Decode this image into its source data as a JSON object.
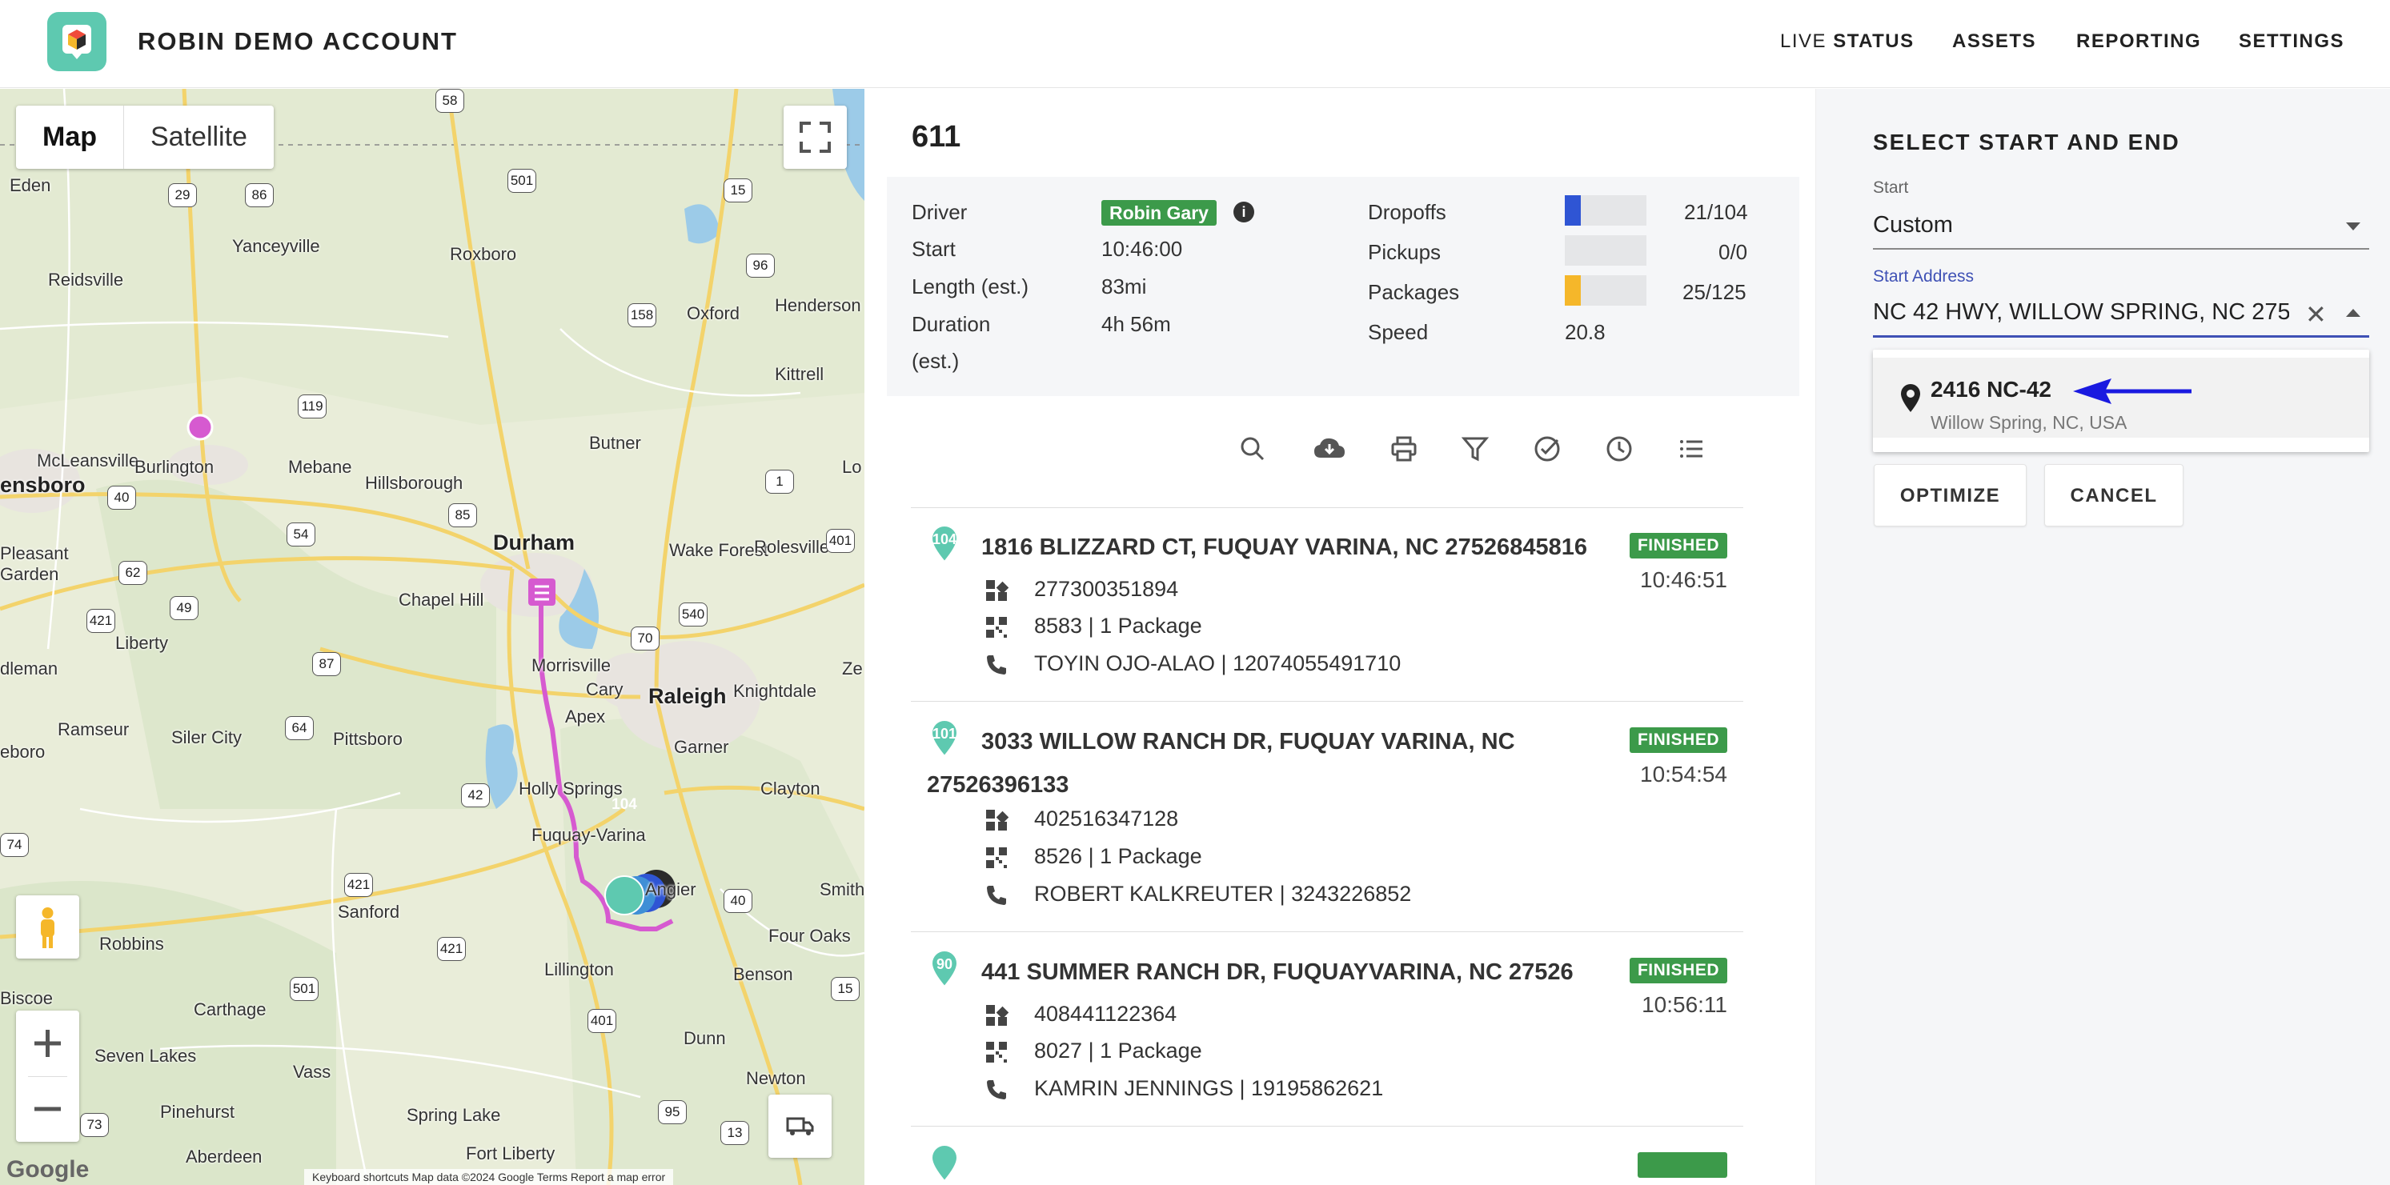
{
  "header": {
    "account_name": "ROBIN DEMO ACCOUNT",
    "nav": {
      "live_word": "LIVE",
      "status_word": "STATUS",
      "assets": "ASSETS",
      "reporting": "REPORTING",
      "settings": "SETTINGS"
    }
  },
  "map": {
    "type_map": "Map",
    "type_satellite": "Satellite",
    "cities": [
      "Eden",
      "Yanceyville",
      "Roxboro",
      "Reidsville",
      "Oxford",
      "Henderson",
      "Kittrell",
      "Butner",
      "McLeansville",
      "Burlington",
      "Mebane",
      "Hillsborough",
      "ensboro",
      "Durham",
      "Wake Forest",
      "Pleasant Garden",
      "Chapel Hill",
      "Rolesville",
      "Liberty",
      "Morrisville",
      "Cary",
      "Raleigh",
      "Knightdale",
      "Apex",
      "dleman",
      "Ramseur",
      "Siler City",
      "Pittsboro",
      "Garner",
      "Holly Springs",
      "Clayton",
      "Fuquay-Varina",
      "Angier",
      "Smith",
      "Four Oaks",
      "Sanford",
      "Robbins",
      "Lillington",
      "Benson",
      "Biscoe",
      "Carthage",
      "Seven Lakes",
      "Vass",
      "Dunn",
      "Pinehurst",
      "Spring Lake",
      "Newton",
      "Aberdeen",
      "Fort Liberty",
      "eboro",
      "Lo",
      "Ze"
    ],
    "shields": [
      "58",
      "29",
      "86",
      "501",
      "15",
      "96",
      "158",
      "119",
      "85",
      "40",
      "54",
      "62",
      "49",
      "421",
      "87",
      "70",
      "540",
      "1",
      "401",
      "64",
      "421",
      "42",
      "501",
      "401",
      "40",
      "421",
      "95",
      "13",
      "15",
      "1",
      "73",
      "74"
    ],
    "footer": "Keyboard shortcuts   Map data ©2024 Google   Terms   Report a map error",
    "google": "Google",
    "marker_label": "104"
  },
  "route": {
    "id": "611",
    "summary": {
      "driver_label": "Driver",
      "driver_name": "Robin Gary",
      "start_label": "Start",
      "start_value": "10:46:00",
      "length_label": "Length (est.)",
      "length_value": "83mi",
      "duration_label": "Duration",
      "duration_label_2": "(est.)",
      "duration_value": "4h 56m",
      "dropoffs_label": "Dropoffs",
      "dropoffs_value": "21/104",
      "dropoffs_fraction": 0.2,
      "pickups_label": "Pickups",
      "pickups_value": "0/0",
      "pickups_fraction": 0,
      "packages_label": "Packages",
      "packages_value": "25/125",
      "packages_fraction": 0.2,
      "speed_label": "Speed",
      "speed_value": "20.8"
    },
    "toolbar_icons": [
      "search-icon",
      "cloud-download-icon",
      "print-icon",
      "filter-icon",
      "check-circle-icon",
      "clock-icon",
      "list-icon"
    ],
    "stops": [
      {
        "number": "104",
        "address": "1816 BLIZZARD CT, FUQUAY VARINA, NC 27526845816",
        "status": "FINISHED",
        "time": "10:46:51",
        "barcode": "277300351894",
        "packages": "8583 | 1 Package",
        "contact": "TOYIN OJO-ALAO | 12074055491710"
      },
      {
        "number": "101",
        "address_line1": "3033 WILLOW RANCH DR, FUQUAY VARINA, NC",
        "address_line2": "27526396133",
        "status": "FINISHED",
        "time": "10:54:54",
        "barcode": "402516347128",
        "packages": "8526 | 1 Package",
        "contact": "ROBERT KALKREUTER | 3243226852"
      },
      {
        "number": "90",
        "address": "441 SUMMER RANCH DR, FUQUAYVARINA, NC 27526",
        "status": "FINISHED",
        "time": "10:56:11",
        "barcode": "408441122364",
        "packages": "8027 | 1 Package",
        "contact": "KAMRIN JENNINGS | 19195862621"
      }
    ]
  },
  "optimize": {
    "title": "SELECT START AND END",
    "start_label": "Start",
    "start_value": "Custom",
    "start_address_label": "Start Address",
    "start_address_value": "NC 42 HWY, WILLOW SPRING, NC 27592",
    "suggestion_main": "2416 NC-42",
    "suggestion_sub": "Willow Spring, NC, USA",
    "optimize_label": "OPTIMIZE",
    "cancel_label": "CANCEL"
  },
  "colors": {
    "accent": "#3f51b5",
    "finished": "#3c9a4a",
    "dropoffs_bar": "#2f55d4",
    "packages_bar": "#f5b72a",
    "route_line": "#d65ad0",
    "stop_pin": "#5ec9b0",
    "arrow": "#1a1ae0"
  }
}
